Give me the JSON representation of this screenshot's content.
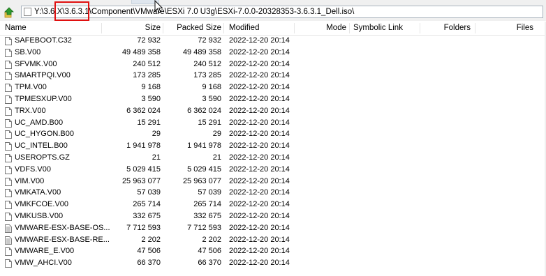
{
  "address": {
    "path": "Y:\\3.6.X\\3.6.3.1\\Component\\VMware\\ESXi 7.0 U3g\\ESXi-7.0.0-20328353-3.6.3.1_Dell.iso\\"
  },
  "columns": {
    "name": "Name",
    "size": "Size",
    "packed": "Packed Size",
    "modified": "Modified",
    "mode": "Mode",
    "symlink": "Symbolic Link",
    "folders": "Folders",
    "files": "Files"
  },
  "files": [
    {
      "name": "SAFEBOOT.C32",
      "size": "72 932",
      "packed": "72 932",
      "modified": "2022-12-20 20:14"
    },
    {
      "name": "SB.V00",
      "size": "49 489 358",
      "packed": "49 489 358",
      "modified": "2022-12-20 20:14"
    },
    {
      "name": "SFVMK.V00",
      "size": "240 512",
      "packed": "240 512",
      "modified": "2022-12-20 20:14"
    },
    {
      "name": "SMARTPQI.V00",
      "size": "173 285",
      "packed": "173 285",
      "modified": "2022-12-20 20:14"
    },
    {
      "name": "TPM.V00",
      "size": "9 168",
      "packed": "9 168",
      "modified": "2022-12-20 20:14"
    },
    {
      "name": "TPMESXUP.V00",
      "size": "3 590",
      "packed": "3 590",
      "modified": "2022-12-20 20:14"
    },
    {
      "name": "TRX.V00",
      "size": "6 362 024",
      "packed": "6 362 024",
      "modified": "2022-12-20 20:14"
    },
    {
      "name": "UC_AMD.B00",
      "size": "15 291",
      "packed": "15 291",
      "modified": "2022-12-20 20:14"
    },
    {
      "name": "UC_HYGON.B00",
      "size": "29",
      "packed": "29",
      "modified": "2022-12-20 20:14"
    },
    {
      "name": "UC_INTEL.B00",
      "size": "1 941 978",
      "packed": "1 941 978",
      "modified": "2022-12-20 20:14"
    },
    {
      "name": "USEROPTS.GZ",
      "size": "21",
      "packed": "21",
      "modified": "2022-12-20 20:14"
    },
    {
      "name": "VDFS.V00",
      "size": "5 029 415",
      "packed": "5 029 415",
      "modified": "2022-12-20 20:14"
    },
    {
      "name": "VIM.V00",
      "size": "25 963 077",
      "packed": "25 963 077",
      "modified": "2022-12-20 20:14"
    },
    {
      "name": "VMKATA.V00",
      "size": "57 039",
      "packed": "57 039",
      "modified": "2022-12-20 20:14"
    },
    {
      "name": "VMKFCOE.V00",
      "size": "265 714",
      "packed": "265 714",
      "modified": "2022-12-20 20:14"
    },
    {
      "name": "VMKUSB.V00",
      "size": "332 675",
      "packed": "332 675",
      "modified": "2022-12-20 20:14"
    },
    {
      "name": "VMWARE-ESX-BASE-OS...",
      "size": "7 712 593",
      "packed": "7 712 593",
      "modified": "2022-12-20 20:14"
    },
    {
      "name": "VMWARE-ESX-BASE-RE...",
      "size": "2 202",
      "packed": "2 202",
      "modified": "2022-12-20 20:14"
    },
    {
      "name": "VMWARE_E.V00",
      "size": "47 506",
      "packed": "47 506",
      "modified": "2022-12-20 20:14"
    },
    {
      "name": "VMW_AHCI.V00",
      "size": "66 370",
      "packed": "66 370",
      "modified": "2022-12-20 20:14"
    }
  ],
  "icons": {
    "up": "up-folder-icon",
    "file": "file-icon",
    "text_file": "text-file-icon",
    "cursor": "mouse-cursor-icon"
  },
  "colors": {
    "highlight": "#e01010",
    "up_arrow": "#2e9a2e",
    "up_arrow_accent": "#e2c44a"
  }
}
